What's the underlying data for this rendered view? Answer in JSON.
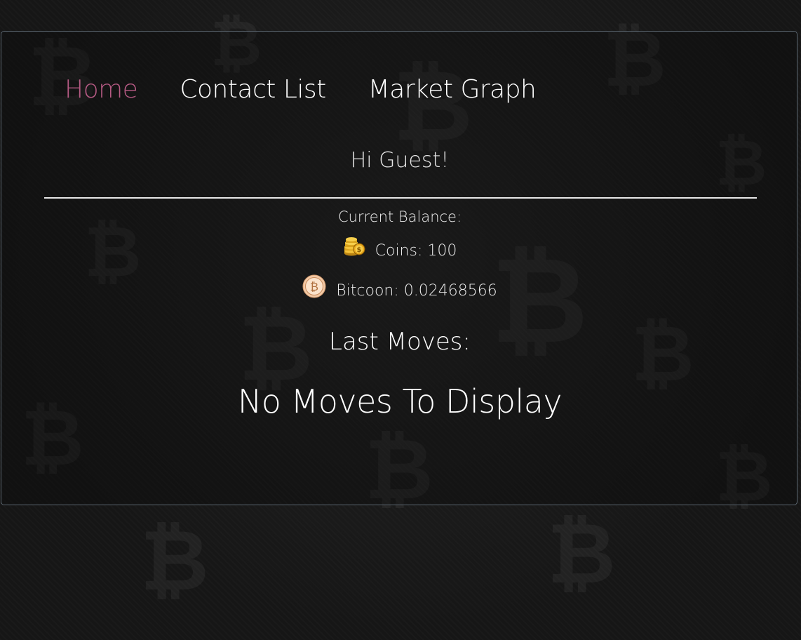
{
  "nav": {
    "items": [
      {
        "label": "Home",
        "active": true
      },
      {
        "label": "Contact List",
        "active": false
      },
      {
        "label": "Market Graph",
        "active": false
      }
    ]
  },
  "greeting": "Hi Guest!",
  "balance": {
    "label": "Current Balance:",
    "coins_text": "Coins: 100",
    "bitcoin_text": "Bitcoon: 0.02468566"
  },
  "moves": {
    "title": "Last Moves:",
    "empty_message": "No Moves To Display"
  },
  "colors": {
    "active_nav": "#b55a83",
    "text": "#ffffff",
    "panel_border": "#5b6670",
    "background": "#161616"
  },
  "icons": {
    "coins": "coin-stack-icon",
    "bitcoin": "bitcoin-icon",
    "background": "bitcoin-pattern-background"
  }
}
